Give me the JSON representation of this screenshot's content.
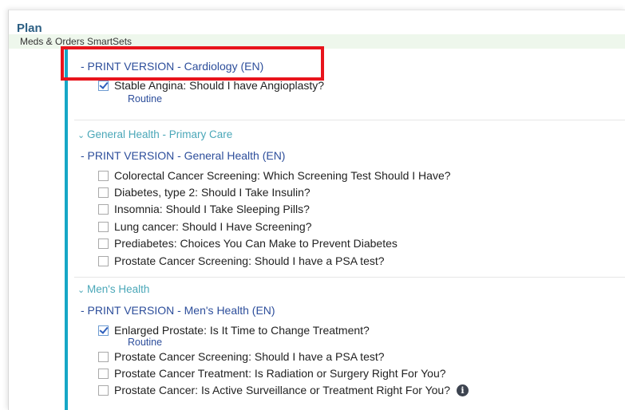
{
  "plan": {
    "title": "Plan",
    "meds_orders_label": "Meds & Orders  SmartSets"
  },
  "cardiology": {
    "print_version": "- PRINT VERSION - Cardiology (EN)",
    "items": [
      {
        "label": "Stable Angina: Should I have Angioplasty?",
        "checked": true,
        "sub": "Routine"
      }
    ]
  },
  "general_health": {
    "group_title": "General Health - Primary Care",
    "print_version": "- PRINT VERSION - General Health (EN)",
    "items": [
      {
        "label": "Colorectal Cancer Screening:  Which Screening Test Should I Have?",
        "checked": false
      },
      {
        "label": "Diabetes, type 2: Should I Take Insulin?",
        "checked": false
      },
      {
        "label": "Insomnia: Should I Take Sleeping Pills?",
        "checked": false
      },
      {
        "label": "Lung cancer: Should I Have Screening?",
        "checked": false
      },
      {
        "label": "Prediabetes: Choices You Can Make to Prevent Diabetes",
        "checked": false
      },
      {
        "label": "Prostate Cancer Screening: Should I have a PSA test?",
        "checked": false
      }
    ]
  },
  "mens_health": {
    "group_title": "Men's Health",
    "print_version": "- PRINT VERSION - Men's Health (EN)",
    "items": [
      {
        "label": "Enlarged Prostate: Is It Time to Change Treatment?",
        "checked": true,
        "sub": "Routine"
      },
      {
        "label": "Prostate Cancer Screening: Should I have a PSA test?",
        "checked": false
      },
      {
        "label": "Prostate Cancer Treatment: Is Radiation or Surgery Right For You?",
        "checked": false
      },
      {
        "label": "Prostate Cancer: Is Active Surveillance or Treatment Right For You?",
        "checked": false
      }
    ]
  },
  "icons": {
    "chevron": "chevron-down-icon",
    "info": "info-icon",
    "info_glyph": "i"
  },
  "colors": {
    "accent_teal": "#16a7c6",
    "link_blue": "#2d4e9b",
    "group_teal": "#4aa7b8",
    "highlight_red": "#e8141c"
  }
}
